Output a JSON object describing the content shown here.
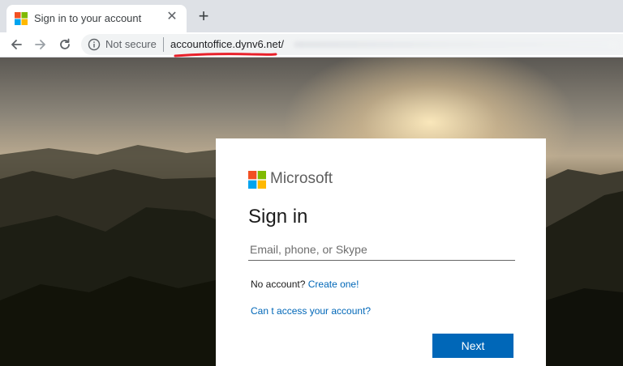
{
  "browser": {
    "tab": {
      "title": "Sign in to your account",
      "close_icon": "close-icon",
      "favicon": "microsoft-logo"
    },
    "new_tab_label": "+",
    "nav": {
      "back_icon": "arrow-left-icon",
      "forward_icon": "arrow-right-icon",
      "reload_icon": "reload-icon"
    },
    "address_bar": {
      "security_icon": "info-icon",
      "security_label": "Not secure",
      "url": "accountoffice.dynv6.net/"
    },
    "annotation_color": "#e8202a"
  },
  "signin": {
    "brand": "Microsoft",
    "logo_colors": [
      "#f25022",
      "#7fba00",
      "#00a4ef",
      "#ffb900"
    ],
    "heading": "Sign in",
    "email_placeholder": "Email, phone, or Skype",
    "email_value": "",
    "no_account_text": "No account?",
    "create_link": "Create one!",
    "cant_access_link": "Can t access your account?",
    "next_label": "Next",
    "accent_color": "#0067b8"
  }
}
